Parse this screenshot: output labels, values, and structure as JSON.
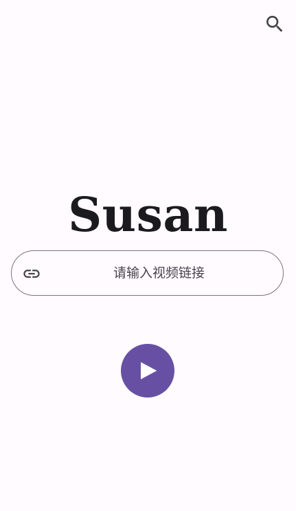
{
  "app": {
    "title": "Susan"
  },
  "toolbar": {
    "search_icon": "search-icon"
  },
  "url_field": {
    "leading_icon": "link-icon",
    "placeholder": "请输入视频链接",
    "value": ""
  },
  "play_button": {
    "icon": "play-icon"
  },
  "colors": {
    "background": "#fffbfe",
    "primary": "#6750a4",
    "outline": "#79747e",
    "on_surface": "#1b1b1f",
    "on_surface_variant": "#49454f",
    "icon": "#444444"
  }
}
